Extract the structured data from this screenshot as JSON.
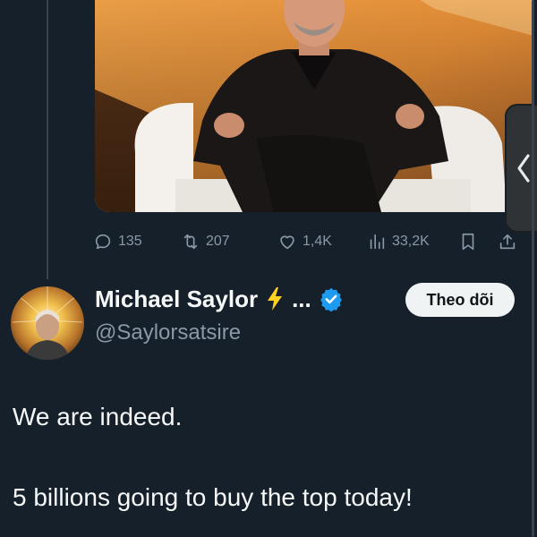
{
  "media": {
    "icon": "photo-of-seated-man"
  },
  "actions": {
    "reply_count": "135",
    "retweet_count": "207",
    "like_count": "1,4K",
    "view_count": "33,2K"
  },
  "author": {
    "name": "Michael Saylor",
    "ellipsis": "...",
    "handle": "@Saylorsatsire",
    "follow_label": "Theo dõi"
  },
  "tweet": {
    "line_1": "We are indeed.",
    "line_2": "5 billions going to buy the top today!"
  },
  "colors": {
    "background": "#15202b",
    "text": "#f7f9f9",
    "muted": "#8b98a5",
    "verified_blue": "#1d9bf0",
    "bolt_yellow": "#ffd21f",
    "follow_bg": "#eff3f4"
  }
}
